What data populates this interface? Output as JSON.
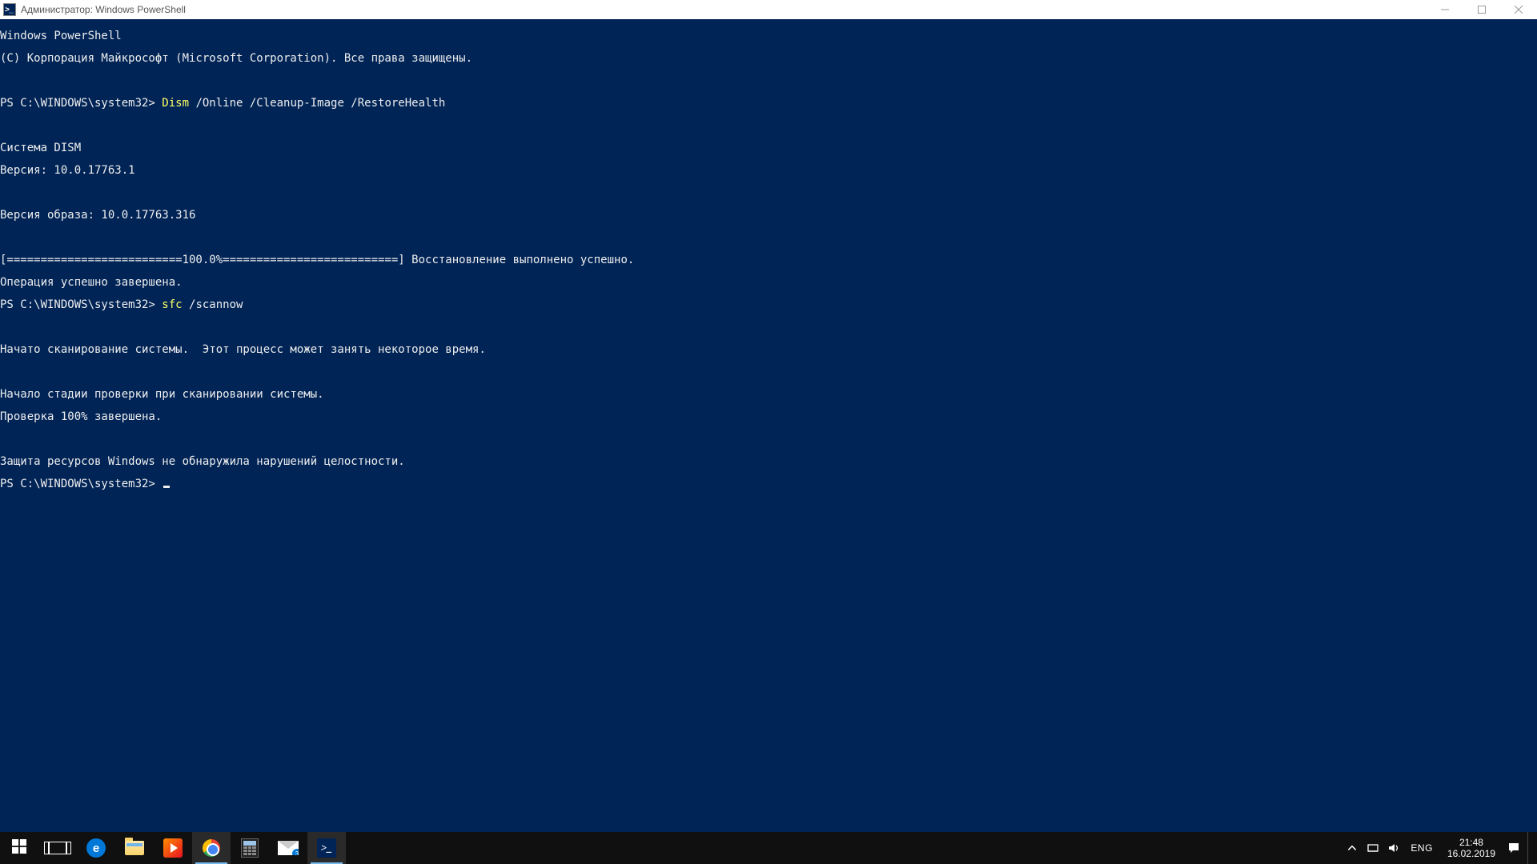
{
  "window": {
    "title": "Администратор: Windows PowerShell"
  },
  "terminal": {
    "banner1": "Windows PowerShell",
    "banner2": "(C) Корпорация Майкрософт (Microsoft Corporation). Все права защищены.",
    "prompt1_pre": "PS C:\\WINDOWS\\system32> ",
    "cmd1a": "Dism",
    "cmd1b": " /Online /Cleanup-Image /RestoreHealth",
    "block1_l1": "Cистема DISM",
    "block1_l2": "Версия: 10.0.17763.1",
    "imgver": "Версия образа: 10.0.17763.316",
    "progress": "[==========================100.0%==========================] Восстановление выполнено успешно.",
    "opdone": "Операция успешно завершена.",
    "prompt2_pre": "PS C:\\WINDOWS\\system32> ",
    "cmd2a": "sfc",
    "cmd2b": " /scannow",
    "scan_l1": "Начато сканирование системы.  Этот процесс может занять некоторое время.",
    "scan_l2": "Начало стадии проверки при сканировании системы.",
    "scan_l3": "Проверка 100% завершена.",
    "result": "Защита ресурсов Windows не обнаружила нарушений целостности.",
    "prompt3": "PS C:\\WINDOWS\\system32> "
  },
  "taskbar": {
    "mail_badge": "3",
    "lang": "ENG",
    "time": "21:48",
    "date": "16.02.2019"
  }
}
